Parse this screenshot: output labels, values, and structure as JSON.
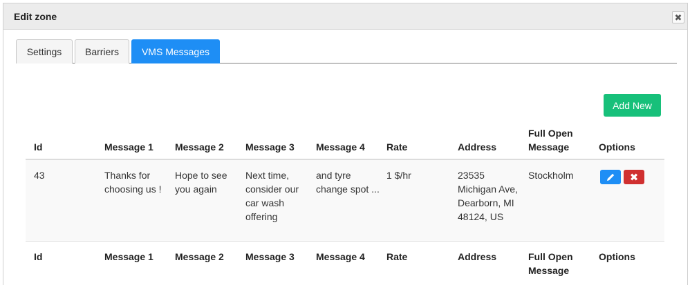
{
  "dialog": {
    "title": "Edit zone",
    "close_icon": "close-icon"
  },
  "tabs": [
    {
      "label": "Settings",
      "active": false
    },
    {
      "label": "Barriers",
      "active": false
    },
    {
      "label": "VMS Messages",
      "active": true
    }
  ],
  "add_button": {
    "label": "Add New"
  },
  "table": {
    "headers": [
      "Id",
      "Message 1",
      "Message 2",
      "Message 3",
      "Message 4",
      "Rate",
      "Address",
      "Full Open Message",
      "Options"
    ],
    "rows": [
      {
        "id": "43",
        "message1": "Thanks for choosing us !",
        "message2": "Hope to see you again",
        "message3": "Next time, consider our car wash offering",
        "message4": "and tyre change spot ...",
        "rate": "1 $/hr",
        "address": "23535 Michigan Ave, Dearborn, MI 48124, US",
        "full_open_message": "Stockholm",
        "options": [
          {
            "icon": "pencil-icon",
            "action": "edit",
            "color": "#1e8ef5"
          },
          {
            "icon": "close-icon",
            "action": "delete",
            "color": "#d03030"
          }
        ]
      }
    ],
    "footers": [
      "Id",
      "Message 1",
      "Message 2",
      "Message 3",
      "Message 4",
      "Rate",
      "Address",
      "Full Open Message",
      "Options"
    ]
  },
  "colors": {
    "tab_active": "#1e8ef5",
    "add_button": "#17c07a",
    "delete_button": "#d03030"
  }
}
